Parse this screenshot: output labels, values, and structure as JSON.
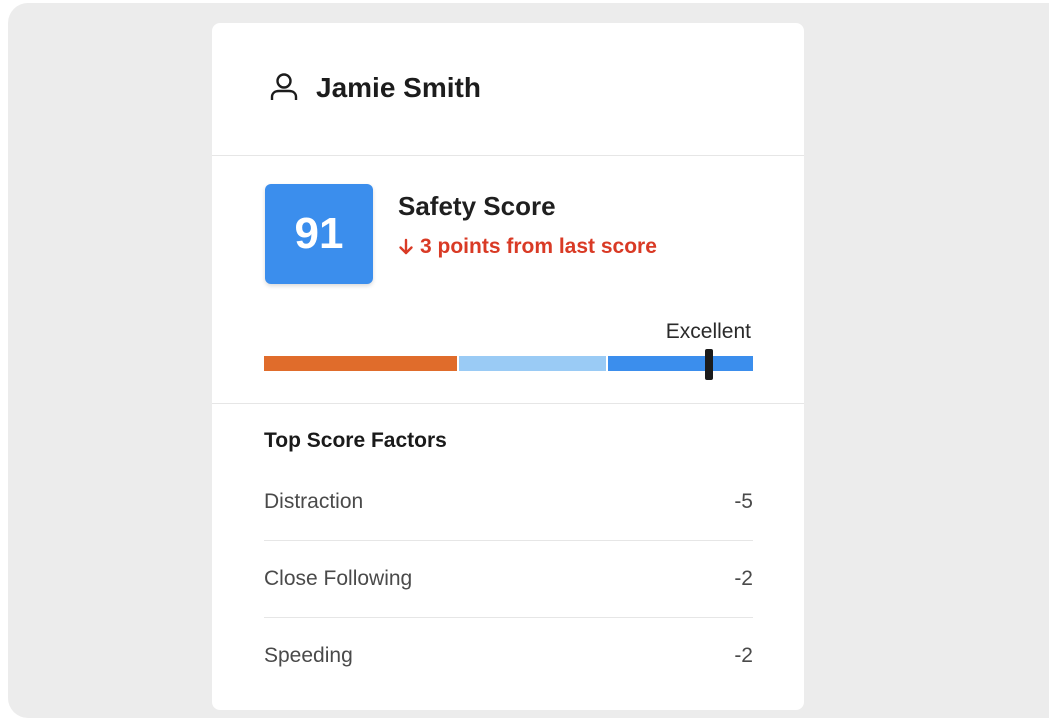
{
  "user": {
    "name": "Jamie Smith",
    "icon": "user-icon"
  },
  "score": {
    "value": "91",
    "title": "Safety Score",
    "change_icon": "arrow-down-icon",
    "change_text": "3 points from last score",
    "rating_label": "Excellent",
    "colors": {
      "box": "#3b8eed",
      "change": "#d93a25"
    },
    "bar": {
      "segments": [
        {
          "name": "low",
          "color": "#e06c2b"
        },
        {
          "name": "mid",
          "color": "#9acbf5"
        },
        {
          "name": "high",
          "color": "#3b8eed"
        }
      ],
      "marker_fraction": 0.91
    }
  },
  "factors": {
    "title": "Top Score Factors",
    "items": [
      {
        "label": "Distraction",
        "value": "-5"
      },
      {
        "label": "Close Following",
        "value": "-2"
      },
      {
        "label": "Speeding",
        "value": "-2"
      }
    ]
  }
}
